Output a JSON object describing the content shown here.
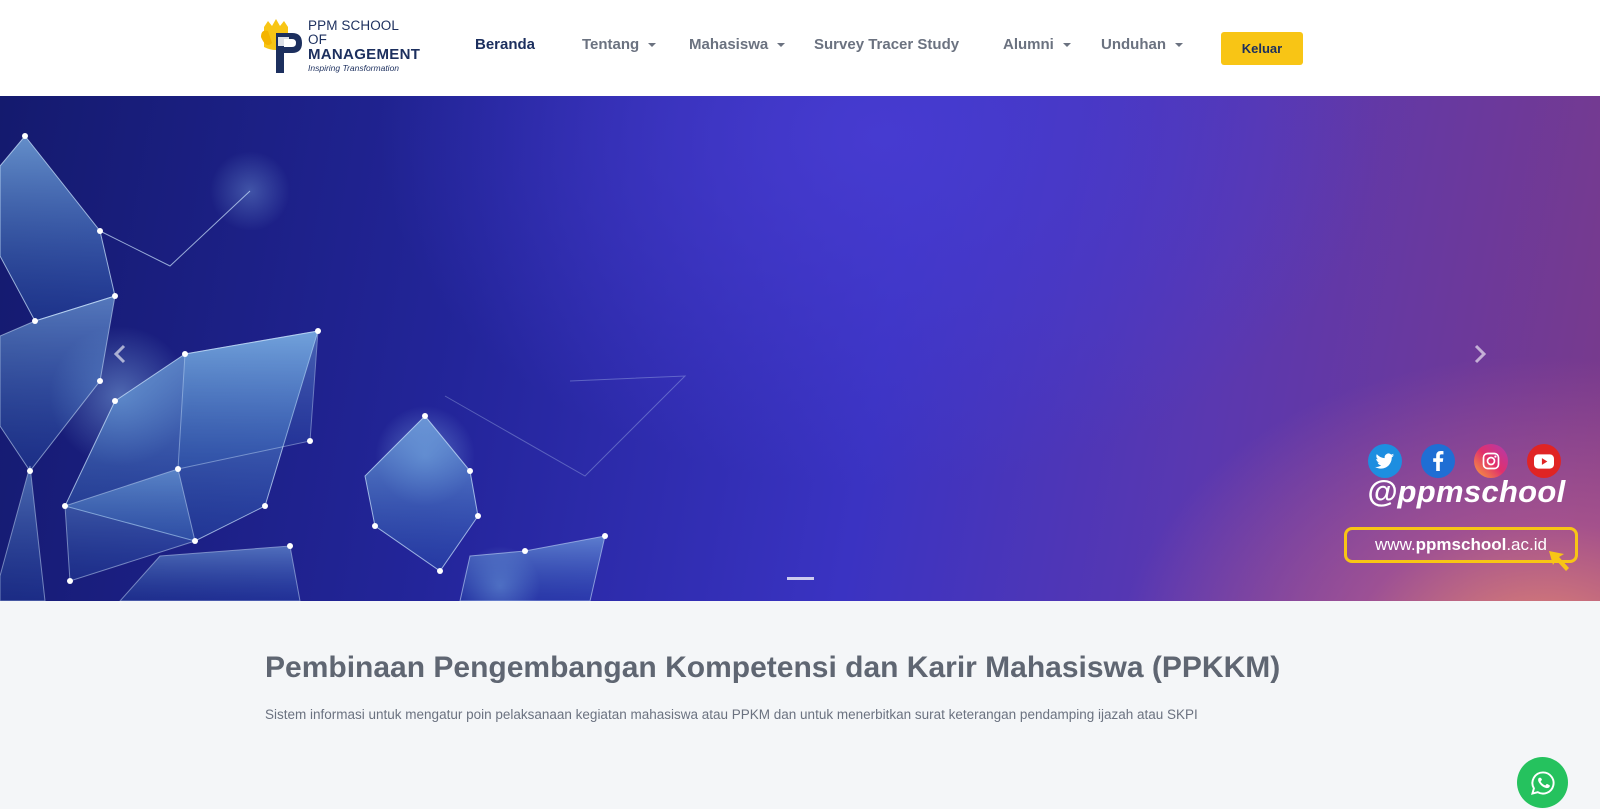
{
  "header": {
    "logo": {
      "line1": "PPM SCHOOL OF",
      "line2": "MANAGEMENT",
      "tagline": "Inspiring Transformation"
    },
    "nav": [
      {
        "label": "Beranda",
        "active": true,
        "dropdown": false
      },
      {
        "label": "Tentang",
        "active": false,
        "dropdown": true
      },
      {
        "label": "Mahasiswa",
        "active": false,
        "dropdown": true
      },
      {
        "label": "Survey Tracer Study",
        "active": false,
        "dropdown": false
      },
      {
        "label": "Alumni",
        "active": false,
        "dropdown": true
      },
      {
        "label": "Unduhan",
        "active": false,
        "dropdown": true
      }
    ],
    "logout_label": "Keluar"
  },
  "carousel": {
    "social_icons": [
      "twitter-icon",
      "facebook-icon",
      "instagram-icon",
      "youtube-icon"
    ],
    "handle": "@ppmschool",
    "url_prefix": "www.",
    "url_bold": "ppmschool",
    "url_suffix": ".ac.id",
    "slide_count": 1,
    "active_slide": 1
  },
  "main": {
    "title": "Pembinaan Pengembangan Kompetensi dan Karir Mahasiswa (PPKKM)",
    "description": "Sistem informasi untuk mengatur poin pelaksanaan kegiatan mahasiswa atau PPKM dan untuk menerbitkan surat keterangan pendamping ijazah atau SKPI"
  },
  "colors": {
    "brand_navy": "#1c2f5e",
    "accent_yellow": "#f8c515",
    "whatsapp_green": "#25c25e"
  }
}
